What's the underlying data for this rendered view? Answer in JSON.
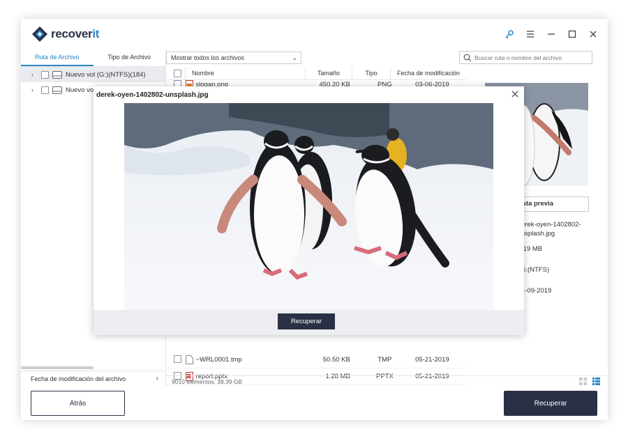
{
  "app": {
    "brand_prefix": "recover",
    "brand_suffix": "it"
  },
  "window_controls": [
    "key-icon",
    "menu-icon",
    "minimize-icon",
    "maximize-icon",
    "close-icon"
  ],
  "left": {
    "tabs": [
      {
        "label": "Ruta de Archivo",
        "active": true
      },
      {
        "label": "Tipo de Archivo",
        "active": false
      }
    ],
    "tree": [
      {
        "label": "Nuevo vol (G:)(NTFS)(184)",
        "selected": true
      },
      {
        "label": "Nuevo vol",
        "selected": false
      }
    ],
    "footer_label": "Fecha de modificación del archivo"
  },
  "toolbar": {
    "filter_value": "Mostrar todos los archivos",
    "search_placeholder": "Buscar ruta o nombre del archivo"
  },
  "table": {
    "headers": {
      "name": "Nombre",
      "size": "Tamaño",
      "type": "Tipo",
      "date": "Fecha de modificación"
    },
    "rows_top": [
      {
        "name": "slogan.png",
        "size": "450.20 KB",
        "type": "PNG",
        "date": "03-06-2019"
      }
    ],
    "rows_bottom": [
      {
        "name": "~WRL0001.tmp",
        "size": "50.50 KB",
        "type": "TMP",
        "date": "05-21-2019"
      },
      {
        "name": "report.pptx",
        "size": "1.28 MB",
        "type": "PPTX",
        "date": "05-21-2019"
      }
    ],
    "footer": "9010 elementos, 38.39  GB"
  },
  "preview": {
    "button_label": "ista previa",
    "name_line1": "erek-oyen-1402802-",
    "name_line2": "nsplash.jpg",
    "size": ".19  MB",
    "fs": "S:(NTFS)",
    "date": "4-09-2019"
  },
  "modal": {
    "title": "derek-oyen-1402802-unsplash.jpg",
    "button_label": "Recuperar"
  },
  "buttons": {
    "back": "Atrás",
    "recover": "Recuperar"
  },
  "colors": {
    "primary": "#2a3045",
    "accent": "#2a86c9"
  }
}
